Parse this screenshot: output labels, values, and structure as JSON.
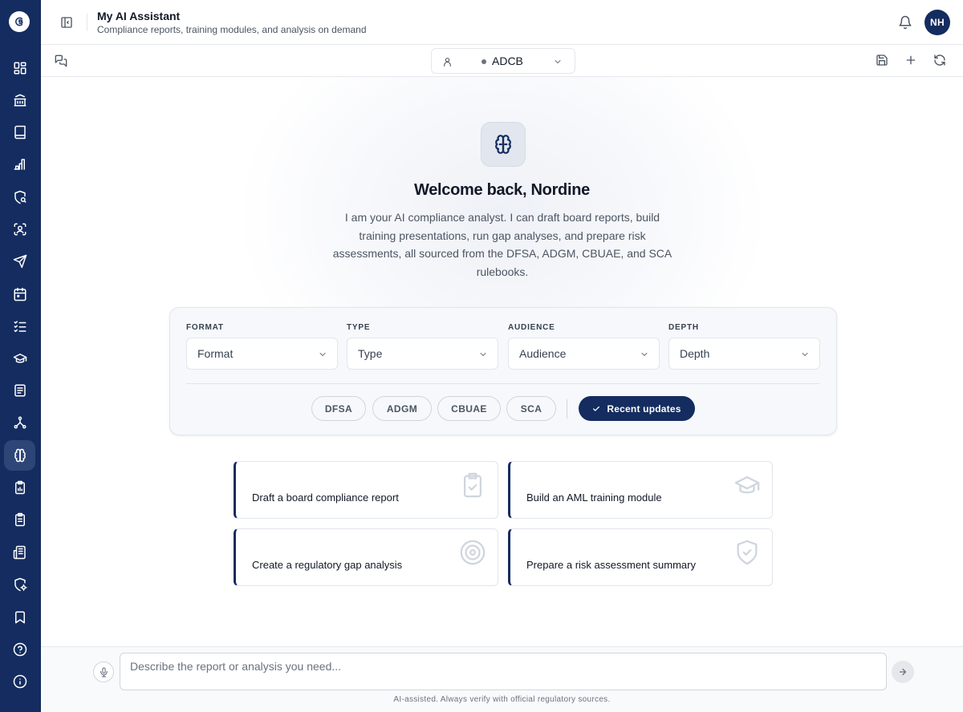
{
  "sidebar": {
    "logo_icon": "brand-logo-icon",
    "items": [
      {
        "icon": "dashboard-grid-icon",
        "active": false
      },
      {
        "icon": "bank-icon",
        "active": false
      },
      {
        "icon": "book-icon",
        "active": false
      },
      {
        "icon": "bar-chart-icon",
        "active": false
      },
      {
        "icon": "shield-search-icon",
        "active": false
      },
      {
        "icon": "face-scan-icon",
        "active": false
      },
      {
        "icon": "send-icon",
        "active": false
      },
      {
        "icon": "calendar-icon",
        "active": false
      },
      {
        "icon": "checklist-icon",
        "active": false
      },
      {
        "icon": "graduation-cap-icon",
        "active": false
      },
      {
        "icon": "document-icon",
        "active": false
      },
      {
        "icon": "network-icon",
        "active": false
      },
      {
        "icon": "brain-icon",
        "active": true
      },
      {
        "icon": "clipboard-chart-icon",
        "active": false
      },
      {
        "icon": "clipboard-icon",
        "active": false
      },
      {
        "icon": "newspaper-icon",
        "active": false
      },
      {
        "icon": "shield-settings-icon",
        "active": false
      },
      {
        "icon": "bookmark-icon",
        "active": false
      },
      {
        "icon": "help-circle-icon",
        "active": false
      },
      {
        "icon": "info-icon",
        "active": false
      }
    ]
  },
  "header": {
    "title": "My AI Assistant",
    "subtitle": "Compliance reports, training modules, and analysis on demand",
    "avatar_initials": "NH"
  },
  "toolbar": {
    "entity": "ADCB"
  },
  "main": {
    "welcome": "Welcome back, Nordine",
    "intro": "I am your AI compliance analyst. I can draft board reports, build training presentations, run gap analyses, and prepare risk assessments, all sourced from the DFSA, ADGM, CBUAE, and SCA rulebooks.",
    "config": {
      "format": {
        "label": "FORMAT",
        "value": "Format"
      },
      "type": {
        "label": "TYPE",
        "value": "Type"
      },
      "audience": {
        "label": "AUDIENCE",
        "value": "Audience"
      },
      "depth": {
        "label": "DEPTH",
        "value": "Depth"
      },
      "sources": [
        "DFSA",
        "ADGM",
        "CBUAE",
        "SCA"
      ],
      "recent_updates": "Recent updates"
    },
    "prompts": [
      {
        "label": "Draft a board compliance report",
        "icon": "clipboard-check-icon"
      },
      {
        "label": "Build an AML training module",
        "icon": "graduation-cap-icon"
      },
      {
        "label": "Create a regulatory gap analysis",
        "icon": "target-icon"
      },
      {
        "label": "Prepare a risk assessment summary",
        "icon": "shield-check-icon"
      }
    ]
  },
  "footer": {
    "placeholder": "Describe the report or analysis you need...",
    "disclaimer": "AI-assisted. Always verify with official regulatory sources."
  },
  "colors": {
    "brand_navy": "#142c5f",
    "active_nav": "#2e4577",
    "text_primary": "#111827",
    "text_secondary": "#4b5563"
  }
}
